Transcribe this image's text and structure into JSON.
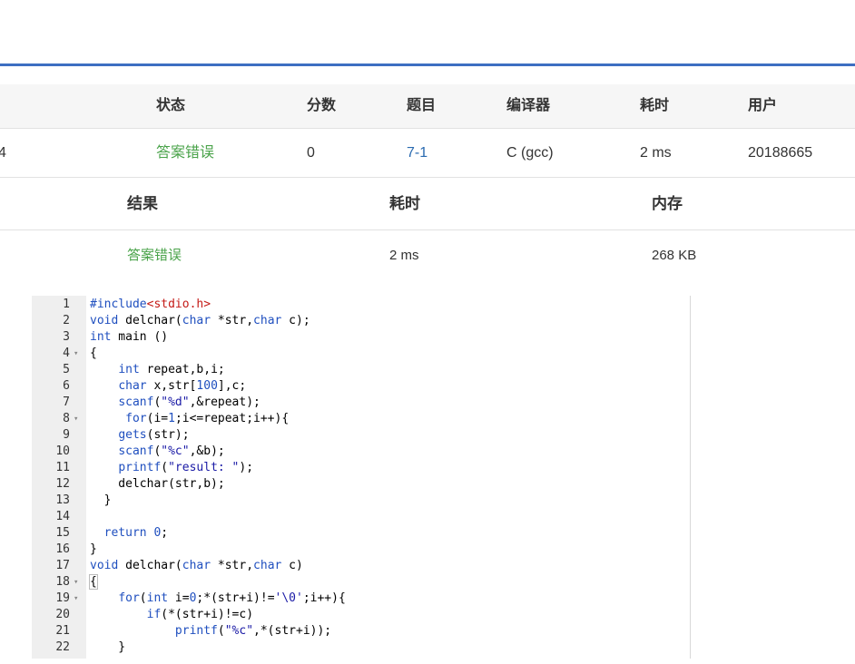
{
  "submission": {
    "headers": [
      "状态",
      "分数",
      "题目",
      "编译器",
      "耗时",
      "用户"
    ],
    "row": {
      "id_fragment": "4",
      "status": "答案错误",
      "score": "0",
      "problem": "7-1",
      "compiler": "C (gcc)",
      "time": "2 ms",
      "user": "20188665"
    }
  },
  "result": {
    "headers": [
      "结果",
      "耗时",
      "内存"
    ],
    "row": {
      "result": "答案错误",
      "time": "2 ms",
      "memory": "268 KB"
    }
  },
  "editor": {
    "lines": [
      {
        "n": "1",
        "fold": false,
        "html": "<span class=\"kw\">#include</span><span class=\"inc\">&lt;stdio.h&gt;</span>"
      },
      {
        "n": "2",
        "fold": false,
        "html": "<span class=\"kw\">void</span> delchar(<span class=\"kw\">char</span> *str,<span class=\"kw\">char</span> c);"
      },
      {
        "n": "3",
        "fold": false,
        "html": "<span class=\"kw\">int</span> main ()"
      },
      {
        "n": "4",
        "fold": true,
        "html": "{"
      },
      {
        "n": "5",
        "fold": false,
        "html": "    <span class=\"kw\">int</span> repeat,b,i;"
      },
      {
        "n": "6",
        "fold": false,
        "html": "    <span class=\"kw\">char</span> x,str[<span class=\"num\">100</span>],c;"
      },
      {
        "n": "7",
        "fold": false,
        "html": "    <span class=\"kw\">scanf</span>(<span class=\"str\">\"%d\"</span>,&amp;repeat);"
      },
      {
        "n": "8",
        "fold": true,
        "html": "     <span class=\"kw\">for</span>(i=<span class=\"num\">1</span>;i&lt;=repeat;i++){"
      },
      {
        "n": "9",
        "fold": false,
        "html": "    <span class=\"kw\">gets</span>(str);"
      },
      {
        "n": "10",
        "fold": false,
        "html": "    <span class=\"kw\">scanf</span>(<span class=\"str\">\"%c\"</span>,&amp;b);"
      },
      {
        "n": "11",
        "fold": false,
        "html": "    <span class=\"kw\">printf</span>(<span class=\"str\">\"result: \"</span>);"
      },
      {
        "n": "12",
        "fold": false,
        "html": "    delchar(str,b);"
      },
      {
        "n": "13",
        "fold": false,
        "html": "  }"
      },
      {
        "n": "14",
        "fold": false,
        "html": ""
      },
      {
        "n": "15",
        "fold": false,
        "html": "  <span class=\"kw\">return</span> <span class=\"num\">0</span>;"
      },
      {
        "n": "16",
        "fold": false,
        "html": "}"
      },
      {
        "n": "17",
        "fold": false,
        "html": "<span class=\"kw\">void</span> delchar(<span class=\"kw\">char</span> *str,<span class=\"kw\">char</span> c)"
      },
      {
        "n": "18",
        "fold": true,
        "html": "<span class=\"bracket-hl\">{</span>"
      },
      {
        "n": "19",
        "fold": true,
        "html": "    <span class=\"kw\">for</span>(<span class=\"kw\">int</span> i=<span class=\"num\">0</span>;*(str+i)!=<span class=\"str\">'\\0'</span>;i++){"
      },
      {
        "n": "20",
        "fold": false,
        "html": "        <span class=\"kw\">if</span>(*(str+i)!=c)"
      },
      {
        "n": "21",
        "fold": false,
        "html": "            <span class=\"kw\">printf</span>(<span class=\"str\">\"%c\"</span>,*(str+i));"
      },
      {
        "n": "22",
        "fold": false,
        "html": "    }"
      }
    ]
  },
  "icons": {
    "fold": "fold-arrow-icon"
  },
  "colors": {
    "accent": "#3d6fc2",
    "status_wrong": "#4aa34a",
    "link": "#2a6ab0"
  }
}
